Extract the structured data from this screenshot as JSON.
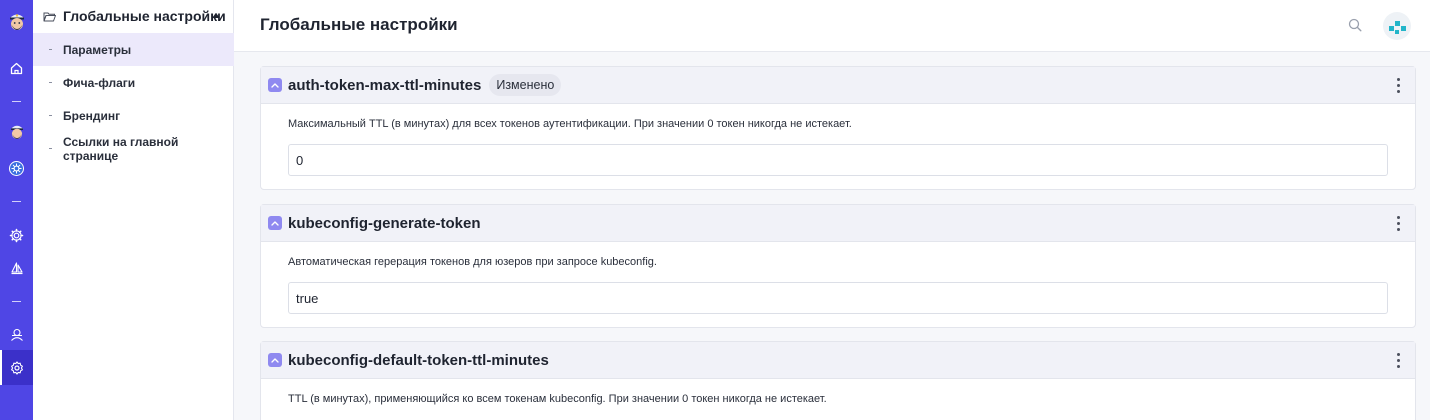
{
  "sidebar": {
    "title": "Глобальные настройки",
    "items": [
      {
        "label": "Параметры",
        "active": true
      },
      {
        "label": "Фича-флаги",
        "active": false
      },
      {
        "label": "Брендинг",
        "active": false
      },
      {
        "label": "Ссылки на главной странице",
        "active": false
      }
    ]
  },
  "rail": {
    "icons": [
      "captain-logo-icon",
      "home-icon",
      "captain-logo-icon",
      "kubernetes-helm-icon",
      "cluster-gear-icon",
      "sailboat-icon",
      "support-icon",
      "settings-icon"
    ],
    "accent": "#4f46e5"
  },
  "header": {
    "title": "Глобальные настройки",
    "search_icon": "search-icon",
    "avatar_icon": "avatar-icon"
  },
  "params": [
    {
      "name": "auth-token-max-ttl-minutes",
      "badge": "Изменено",
      "description": "Максимальный TTL (в минутах) для всех токенов аутентификации. При значении 0 токен никогда не истекает.",
      "value": "0"
    },
    {
      "name": "kubeconfig-generate-token",
      "badge": "",
      "description": "Автоматическая герерация токенов для юзеров при запросе kubeconfig.",
      "value": "true"
    },
    {
      "name": "kubeconfig-default-token-ttl-minutes",
      "badge": "",
      "description": "TTL (в минутах), применяющийся ко всем токенам kubeconfig. При значении 0 токен никогда не истекает.",
      "value": ""
    }
  ]
}
